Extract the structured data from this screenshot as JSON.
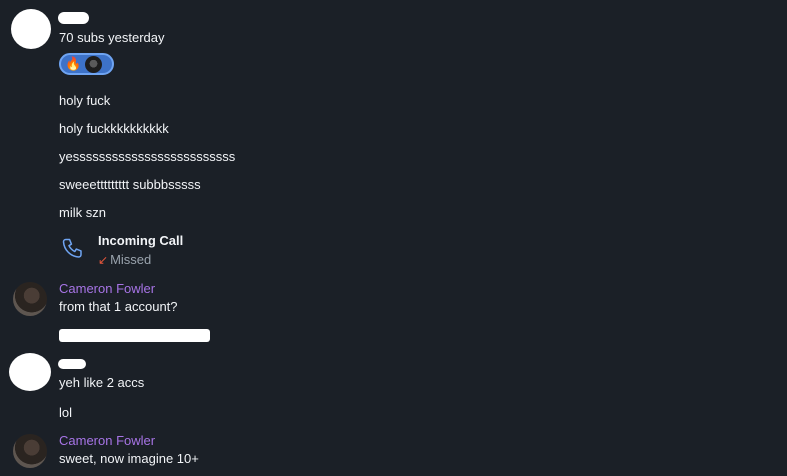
{
  "messages_block_1": {
    "line_1": "70 subs yesterday",
    "reaction": {
      "emoji_1": "🔥",
      "emoji_2_icon": "face-emoji-icon"
    },
    "line_2": "holy fuck",
    "line_3": "holy fuckkkkkkkkkk",
    "line_4": "yesssssssssssssssssssssssss",
    "line_5": "sweeettttttttt subbbsssss",
    "line_6": "milk szn"
  },
  "call": {
    "title": "Incoming Call",
    "status_arrow": "↙",
    "status": "Missed",
    "icon": "phone-icon"
  },
  "messages_block_2": {
    "author": "Cameron Fowler",
    "line_1": "from that 1 account?"
  },
  "messages_block_3": {
    "line_1": "yeh like 2 accs",
    "line_2": "lol"
  },
  "messages_block_4": {
    "author": "Cameron Fowler",
    "line_1": "sweet, now imagine 10+"
  },
  "colors": {
    "background": "#1b2027",
    "author_name": "#a774e6",
    "reaction_bg": "#3d72c8",
    "missed_arrow": "#e5563b"
  }
}
